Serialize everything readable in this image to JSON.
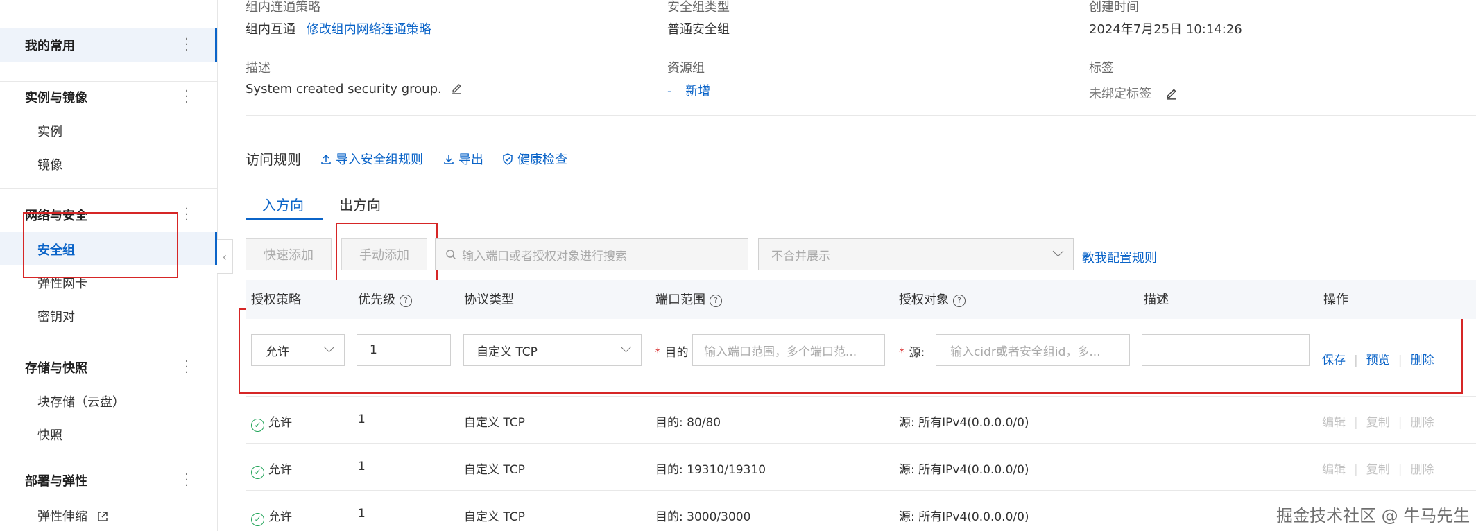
{
  "sidebar": {
    "groups": [
      {
        "title": "我的常用",
        "items": []
      },
      {
        "title": "实例与镜像",
        "items": [
          "实例",
          "镜像"
        ]
      },
      {
        "title": "网络与安全",
        "items": [
          "安全组",
          "弹性网卡",
          "密钥对"
        ]
      },
      {
        "title": "存储与快照",
        "items": [
          "块存储（云盘）",
          "快照"
        ]
      },
      {
        "title": "部署与弹性",
        "items": [
          "弹性伸缩"
        ]
      }
    ]
  },
  "info": {
    "interconnect_label": "组内连通策略",
    "interconnect_value": "组内互通",
    "interconnect_link": "修改组内网络连通策略",
    "type_label": "安全组类型",
    "type_value": "普通安全组",
    "created_label": "创建时间",
    "created_value": "2024年7月25日 10:14:26",
    "desc_label": "描述",
    "desc_value": "System created security group.",
    "rg_label": "资源组",
    "rg_value": "-",
    "rg_link": "新增",
    "tag_label": "标签",
    "tag_value": "未绑定标签"
  },
  "rules": {
    "title": "访问规则",
    "import": "导入安全组规则",
    "export": "导出",
    "health": "健康检查",
    "tabs": [
      "入方向",
      "出方向"
    ],
    "quick_add": "快速添加",
    "manual_add": "手动添加",
    "search_placeholder": "输入端口或者授权对象进行搜索",
    "merge_select": "不合并展示",
    "teach": "教我配置规则",
    "columns": [
      "授权策略",
      "优先级",
      "协议类型",
      "端口范围",
      "授权对象",
      "描述",
      "操作"
    ]
  },
  "edit_row": {
    "policy": "允许",
    "priority": "1",
    "protocol": "自定义 TCP",
    "dest_label": "目的",
    "dest_placeholder": "输入端口范围，多个端口范...",
    "src_label": "源:",
    "src_placeholder": "输入cidr或者安全组id，多...",
    "save": "保存",
    "preview": "预览",
    "delete": "删除"
  },
  "rows": [
    {
      "policy": "允许",
      "priority": "1",
      "protocol": "自定义 TCP",
      "port": "目的: 80/80",
      "source": "源: 所有IPv4(0.0.0.0/0)"
    },
    {
      "policy": "允许",
      "priority": "1",
      "protocol": "自定义 TCP",
      "port": "目的: 19310/19310",
      "source": "源: 所有IPv4(0.0.0.0/0)"
    },
    {
      "policy": "允许",
      "priority": "1",
      "protocol": "自定义 TCP",
      "port": "目的: 3000/3000",
      "source": "源: 所有IPv4(0.0.0.0/0)"
    }
  ],
  "row_ops": {
    "edit": "编辑",
    "copy": "复制",
    "delete": "删除"
  },
  "watermark": "掘金技术社区 @ 牛马先生"
}
